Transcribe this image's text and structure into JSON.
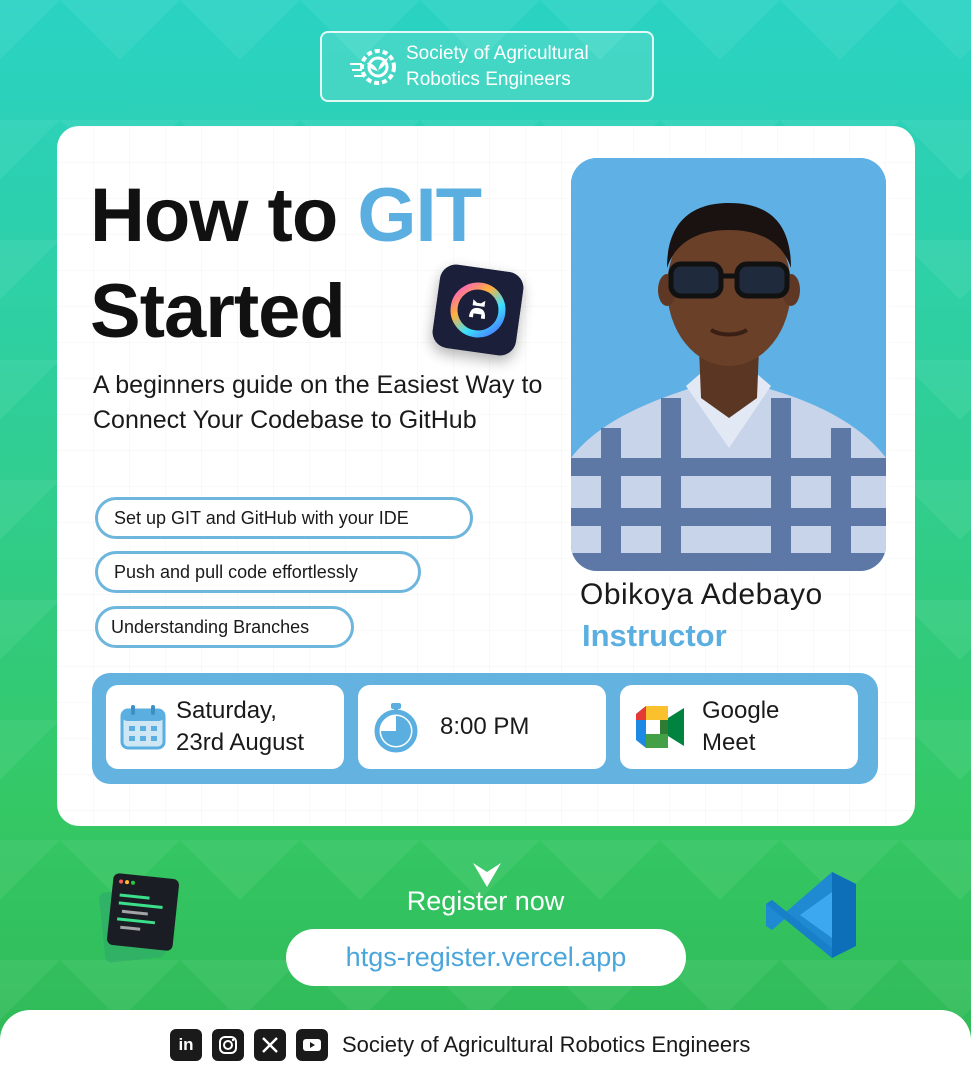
{
  "org_badge": {
    "line1": "Society of Agricultural",
    "line2": "Robotics Engineers",
    "logo_icon": "gear-plant-icon"
  },
  "title": {
    "part1": "How to ",
    "accent": "GIT",
    "part2": "Started",
    "icon": "github-copilot-icon"
  },
  "subtitle": "A beginners guide on the Easiest Way to Connect Your Codebase to GitHub",
  "topics": [
    "Set up GIT and GitHub with your IDE",
    "Push and pull code effortlessly",
    "Understanding Branches"
  ],
  "instructor": {
    "name": "Obikoya Adebayo",
    "role": "Instructor"
  },
  "event": {
    "date_line1": "Saturday,",
    "date_line2": "23rd August",
    "time": "8:00 PM",
    "platform_line1": "Google",
    "platform_line2": "Meet"
  },
  "register": {
    "label": "Register now",
    "link": "htgs-register.vercel.app"
  },
  "footer": {
    "socials": [
      "linkedin-icon",
      "instagram-icon",
      "x-icon",
      "youtube-icon"
    ],
    "text": "Society of Agricultural Robotics Engineers"
  },
  "colors": {
    "accent_blue": "#5aaee0",
    "bg_top": "#2ad2c4",
    "bg_bottom": "#30b856"
  }
}
